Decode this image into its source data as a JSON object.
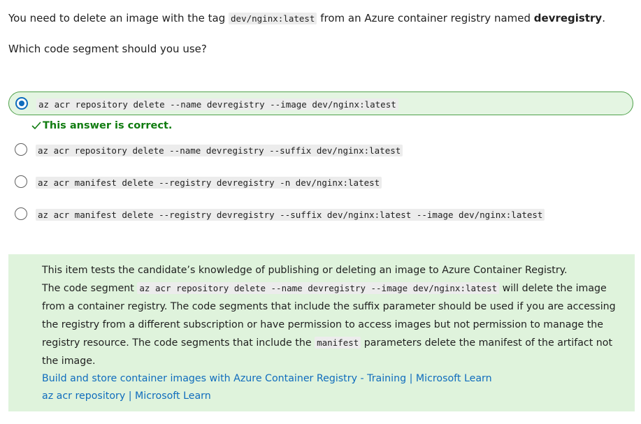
{
  "question": {
    "line1_before": "You need to delete an image with the tag ",
    "line1_code": "dev/nginx:latest",
    "line1_middle": " from an Azure container registry named ",
    "line1_bold": "devregistry",
    "line1_end": ".",
    "line2": "Which code segment should you use?"
  },
  "options": [
    {
      "code": "az acr repository delete --name devregistry --image dev/nginx:latest",
      "selected": true
    },
    {
      "code": "az acr repository delete --name devregistry --suffix dev/nginx:latest",
      "selected": false
    },
    {
      "code": "az acr manifest delete --registry devregistry -n dev/nginx:latest",
      "selected": false
    },
    {
      "code": "az acr manifest delete --registry devregistry --suffix dev/nginx:latest --image dev/nginx:latest",
      "selected": false
    }
  ],
  "feedback": {
    "correct_text": "This answer is correct.",
    "icon": "checkmark-icon",
    "color": "#107c10"
  },
  "explanation": {
    "line1": "This item tests the candidate’s knowledge of publishing or deleting an image to Azure Container Registry.",
    "seg_a": "The code segment ",
    "seg_code1": "az acr repository delete --name devregistry --image dev/nginx:latest",
    "seg_b": " will delete the image from a container registry. The code segments that include the suffix parameter should be used if you are accessing the registry from a different subscription or have permission to access images but not permission to manage the registry resource. The code segments that include the ",
    "seg_code2": "manifest",
    "seg_c": " parameters delete the manifest of the artifact not the image.",
    "links": [
      "Build and store container images with Azure Container Registry - Training | Microsoft Learn",
      "az acr repository | Microsoft Learn"
    ],
    "background": "#dff3dc",
    "link_color": "#0f6cbd"
  },
  "colors": {
    "selected_border": "#4fa14b",
    "selected_bg": "#e4f5e2",
    "radio_accent": "#0f6cbd"
  }
}
